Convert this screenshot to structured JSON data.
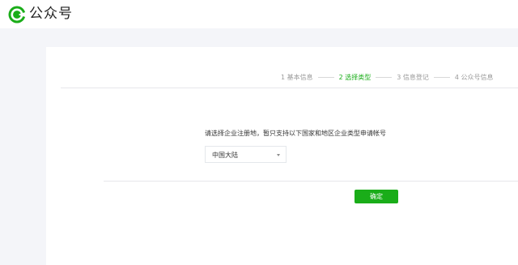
{
  "header": {
    "brand": "公众号",
    "logo_icon": "wechat-official-account-logo-icon",
    "logo_color": "#1aad19"
  },
  "steps": [
    {
      "label": "1 基本信息",
      "active": false
    },
    {
      "label": "2 选择类型",
      "active": true
    },
    {
      "label": "3 信息登记",
      "active": false
    },
    {
      "label": "4 公众号信息",
      "active": false
    }
  ],
  "form": {
    "prompt": "请选择企业注册地，暂只支持以下国家和地区企业类型申请帐号",
    "region_select": {
      "value": "中国大陆",
      "arrow_icon": "caret-down-icon"
    },
    "confirm_label": "确定"
  },
  "colors": {
    "accent": "#1aad19",
    "page_background": "#f4f5f9",
    "muted_text": "#9a9a9a"
  }
}
